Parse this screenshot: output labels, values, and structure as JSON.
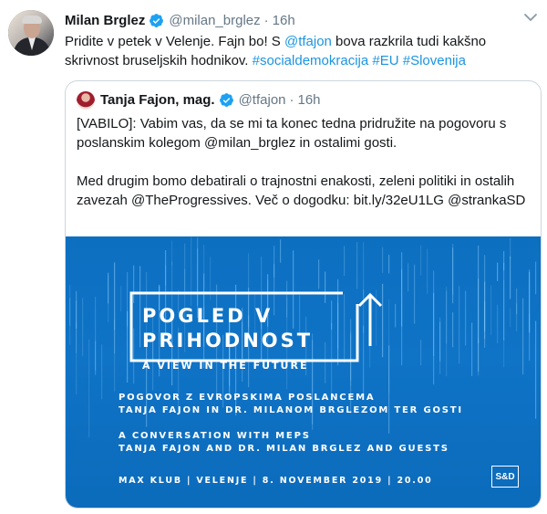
{
  "tweet": {
    "author": {
      "name": "Milan Brglez",
      "handle": "@milan_brglez",
      "time": "16h"
    },
    "text": {
      "part1": "Pridite v petek v Velenje. Fajn bo! S ",
      "mention": "@tfajon",
      "part2": " bova razkrila tudi kakšno skrivnost bruseljskih hodnikov. ",
      "tags": [
        "#socialdemokracija",
        "#EU",
        "#Slovenija"
      ]
    }
  },
  "quoted": {
    "author": {
      "name": "Tanja Fajon, mag.",
      "handle": "@tfajon",
      "time": "16h"
    },
    "para1": "[VABILO]: Vabim vas, da se mi ta konec tedna pridružite na pogovoru s poslanskim kolegom @milan_brglez in ostalimi gosti.",
    "para2": "Med drugim bomo debatirali o trajnostni enakosti, zeleni politiki in ostalih zavezah @TheProgressives. Več o dogodku: bit.ly/32eU1LG @strankaSD",
    "banner": {
      "title_line1": "POGLED V",
      "title_line2": "PRIHODNOST",
      "subtitle": "A VIEW IN THE FUTURE",
      "line1": "POGOVOR Z EVROPSKIMA POSLANCEMA",
      "line2": "TANJA FAJON IN DR. MILANOM BRGLEZOM TER GOSTI",
      "line3": "A CONVERSATION WITH MEPS",
      "line4": "TANJA FAJON AND DR. MILAN BRGLEZ AND GUESTS",
      "line5": "MAX KLUB | VELENJE | 8. NOVEMBER 2019 | 20.00",
      "logo": "S&D"
    }
  },
  "colors": {
    "link": "#1b95e0",
    "secondary": "#657786",
    "banner": "#0f73c6",
    "border": "#ccd6dd"
  },
  "icons": {
    "verified": "verified-badge-icon",
    "menu": "chevron-down-icon"
  }
}
